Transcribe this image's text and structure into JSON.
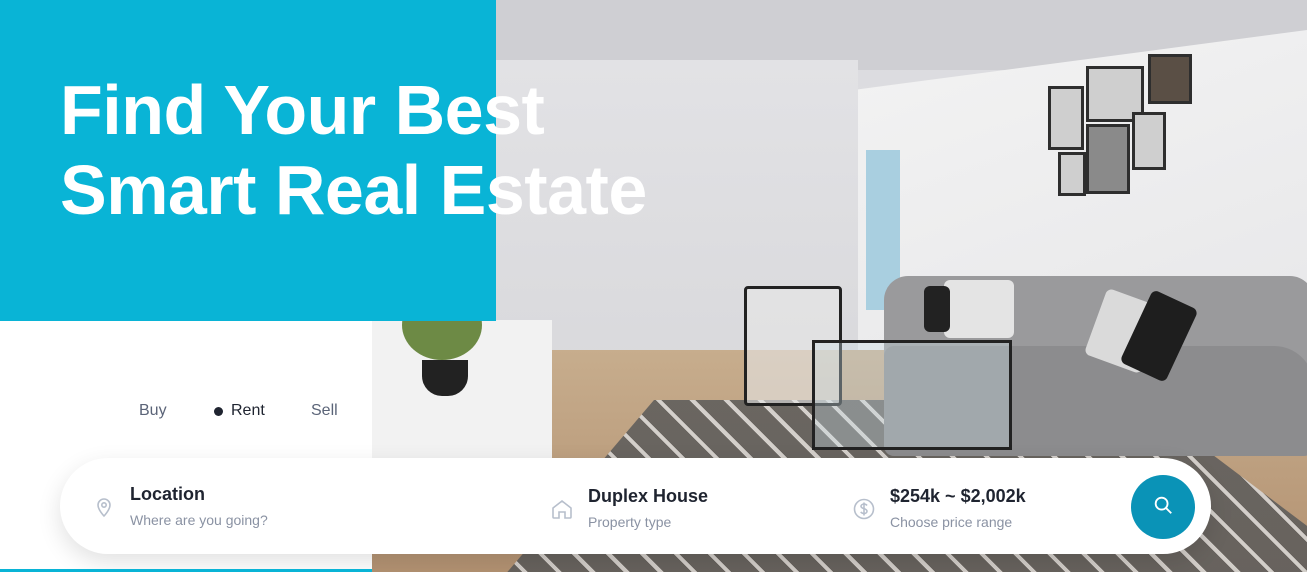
{
  "hero": {
    "title_line1": "Find Your Best",
    "title_line2": "Smart Real Estate"
  },
  "tabs": {
    "items": [
      "Buy",
      "Rent",
      "Sell"
    ],
    "active": "Rent"
  },
  "search": {
    "location": {
      "label": "Location",
      "placeholder": "Where are you going?",
      "icon": "location-pin-icon"
    },
    "property_type": {
      "label": "Duplex House",
      "sub": "Property type",
      "icon": "home-icon"
    },
    "price": {
      "label": "$254k ~ $2,002k",
      "sub": "Choose price range",
      "icon": "dollar-icon"
    },
    "button_icon": "search-icon"
  },
  "colors": {
    "accent": "#09b4d6",
    "button": "#0a93b7",
    "text_dark": "#1f2430",
    "text_muted": "#8a92a3"
  }
}
